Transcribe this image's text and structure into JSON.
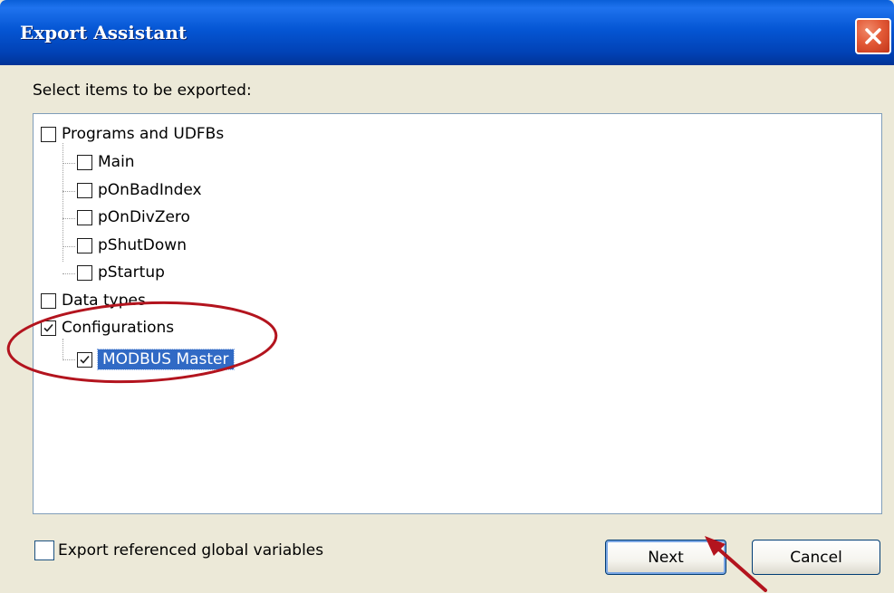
{
  "window": {
    "title": "Export Assistant",
    "close_icon": "close-icon"
  },
  "instruction": "Select items to be exported:",
  "tree": {
    "items": [
      {
        "label": "Programs and UDFBs",
        "checked": false,
        "level": 0
      },
      {
        "label": "Main",
        "checked": false,
        "level": 1
      },
      {
        "label": "pOnBadIndex",
        "checked": false,
        "level": 1
      },
      {
        "label": "pOnDivZero",
        "checked": false,
        "level": 1
      },
      {
        "label": "pShutDown",
        "checked": false,
        "level": 1
      },
      {
        "label": "pStartup",
        "checked": false,
        "level": 1
      },
      {
        "label": "Data types",
        "checked": false,
        "level": 0
      },
      {
        "label": "Configurations",
        "checked": true,
        "level": 0
      },
      {
        "label": "MODBUS Master",
        "checked": true,
        "level": 1,
        "selected": true
      }
    ]
  },
  "footer": {
    "export_globals_label": "Export referenced global variables",
    "export_globals_checked": false,
    "next_label": "Next",
    "cancel_label": "Cancel"
  },
  "colors": {
    "titlebar": "#0556d4",
    "selection": "#316ac5",
    "annotation": "#b3141e"
  }
}
